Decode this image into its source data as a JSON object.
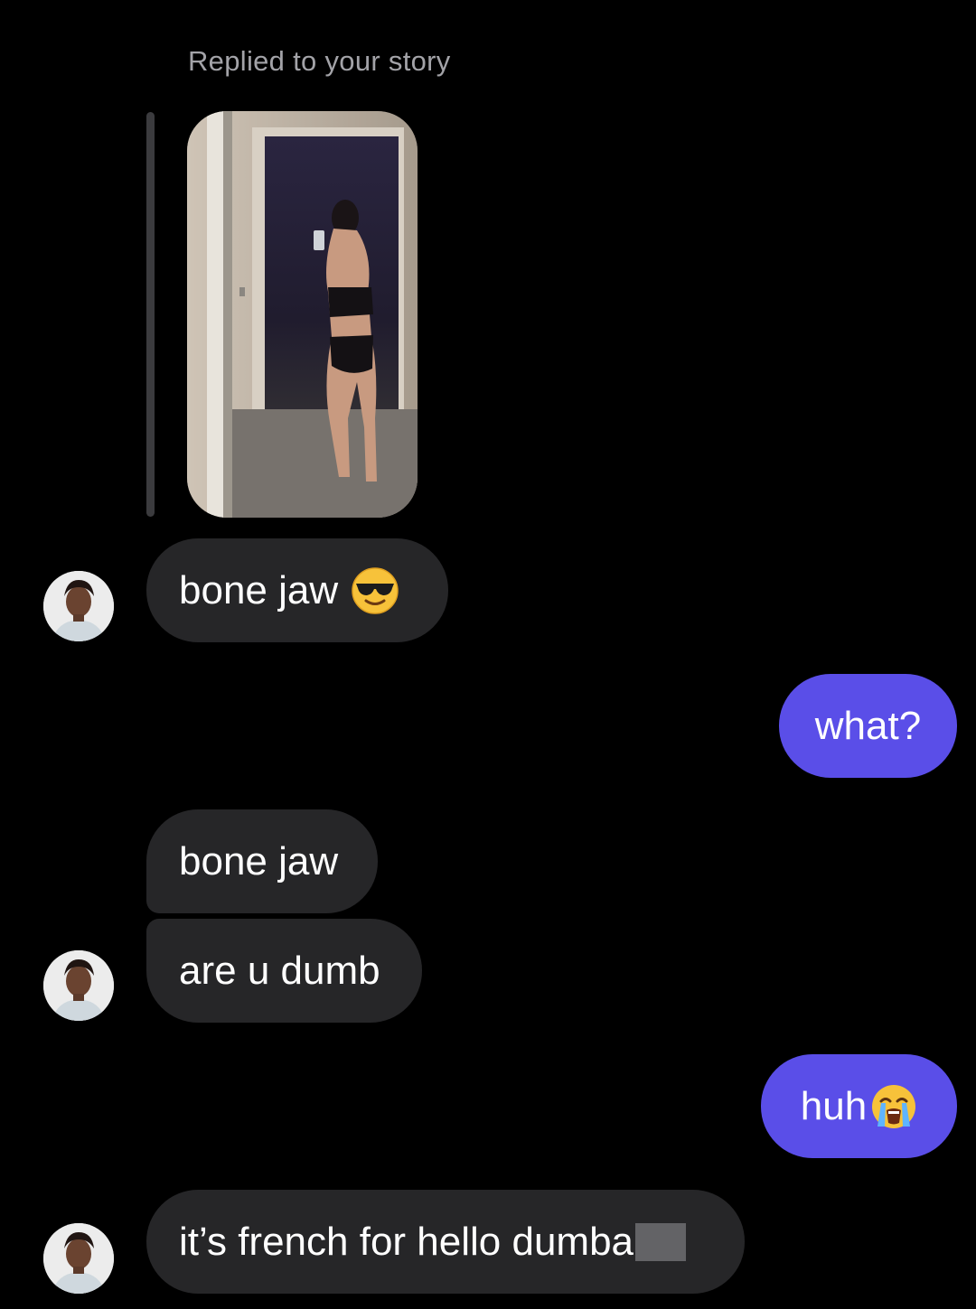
{
  "header": {
    "reply_label": "Replied to your story"
  },
  "colors": {
    "background": "#000000",
    "incoming_bubble": "#262628",
    "outgoing_bubble": "#5a4ee8",
    "reply_label": "#a3a3a8"
  },
  "story": {
    "icon": "story-photo"
  },
  "messages": [
    {
      "direction": "incoming",
      "text": "bone jaw",
      "emoji": "smiling-face-with-sunglasses-icon",
      "avatar": true
    },
    {
      "direction": "outgoing",
      "text": "what?"
    },
    {
      "direction": "incoming",
      "text": "bone jaw",
      "avatar": false
    },
    {
      "direction": "incoming",
      "text": "are u dumb",
      "avatar": true
    },
    {
      "direction": "outgoing",
      "text": "huh",
      "emoji": "loudly-crying-face-icon"
    },
    {
      "direction": "incoming",
      "text": "it’s french for hello dumba",
      "redacted_suffix": true,
      "avatar": true
    }
  ]
}
